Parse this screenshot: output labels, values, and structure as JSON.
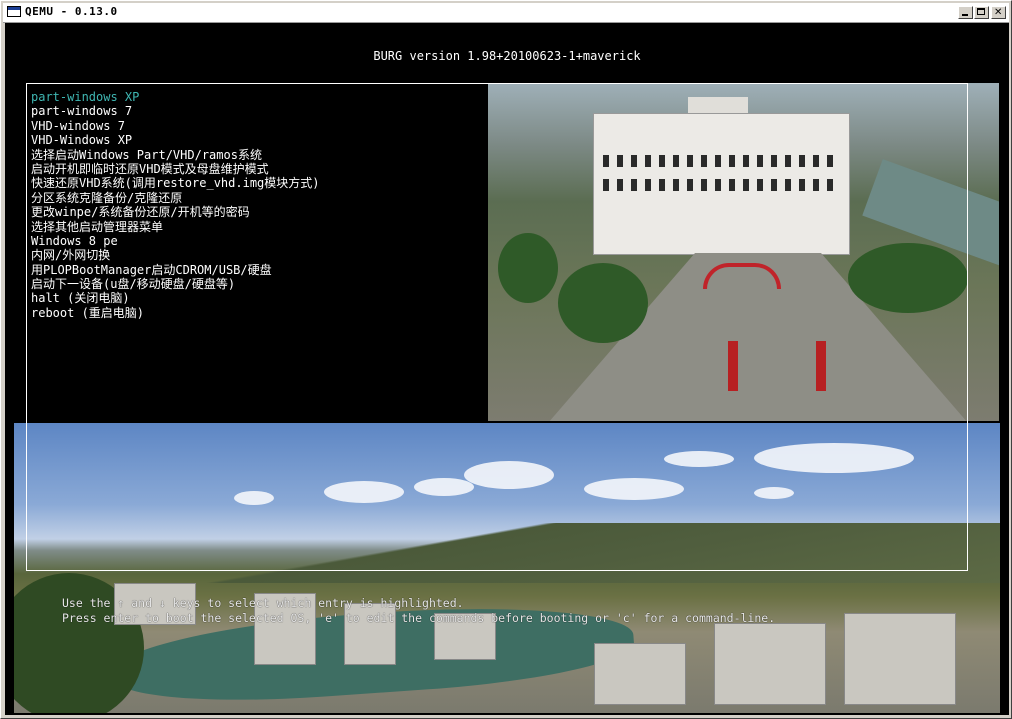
{
  "window": {
    "title": "QEMU - 0.13.0"
  },
  "header": {
    "version": "BURG  version 1.98+20100623-1+maverick"
  },
  "menu": {
    "items": [
      {
        "label": "part-windows XP",
        "selected": true
      },
      {
        "label": "part-windows 7"
      },
      {
        "label": "VHD-windows 7"
      },
      {
        "label": "VHD-Windows XP"
      },
      {
        "label": "选择启动Windows Part/VHD/ramos系统"
      },
      {
        "label": "启动开机即临时还原VHD模式及母盘维护模式"
      },
      {
        "label": "快速还原VHD系统(调用restore_vhd.img模块方式)"
      },
      {
        "label": "分区系统克隆备份/克隆还原"
      },
      {
        "label": "更改winpe/系统备份还原/开机等的密码"
      },
      {
        "label": "选择其他启动管理器菜单"
      },
      {
        "label": "Windows 8 pe"
      },
      {
        "label": "内网/外网切换"
      },
      {
        "label": "用PLOPBootManager启动CDROM/USB/硬盘"
      },
      {
        "label": "启动下一设备(u盘/移动硬盘/硬盘等)"
      },
      {
        "label": "halt (关闭电脑)"
      },
      {
        "label": "reboot (重启电脑)"
      }
    ]
  },
  "help": {
    "line1": "Use the ↑ and ↓ keys to select which entry is highlighted.",
    "line2": "Press enter to boot the selected OS, 'e' to edit the commands before booting or 'c' for a command-line."
  },
  "colors": {
    "selected": "#3fb6b2",
    "text": "#ffffff",
    "background": "#000000"
  }
}
